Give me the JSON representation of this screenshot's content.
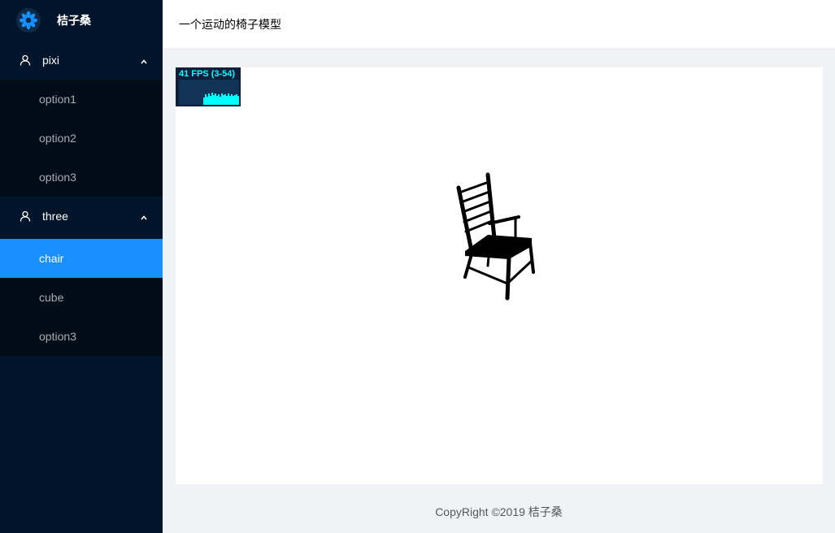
{
  "app": {
    "name": "桔子桑",
    "logo_icon": "flower-logo-icon",
    "accent_color": "#1890ff",
    "sider_color": "#001529"
  },
  "menu": {
    "groups": [
      {
        "title": "pixi",
        "icon": "user-icon",
        "expanded": true,
        "items": [
          "option1",
          "option2",
          "option3"
        ]
      },
      {
        "title": "three",
        "icon": "user-icon",
        "expanded": true,
        "items": [
          "chair",
          "cube",
          "option3"
        ],
        "selected": "chair"
      }
    ]
  },
  "header": {
    "title": "一个运动的椅子模型"
  },
  "stats": {
    "label": "41 FPS (3-54)",
    "fps": 41,
    "min": 3,
    "max": 54,
    "color": "#00ffff"
  },
  "scene": {
    "model": "chair",
    "model_icon": "chair-model"
  },
  "footer": {
    "text": "CopyRight ©2019 桔子桑"
  }
}
